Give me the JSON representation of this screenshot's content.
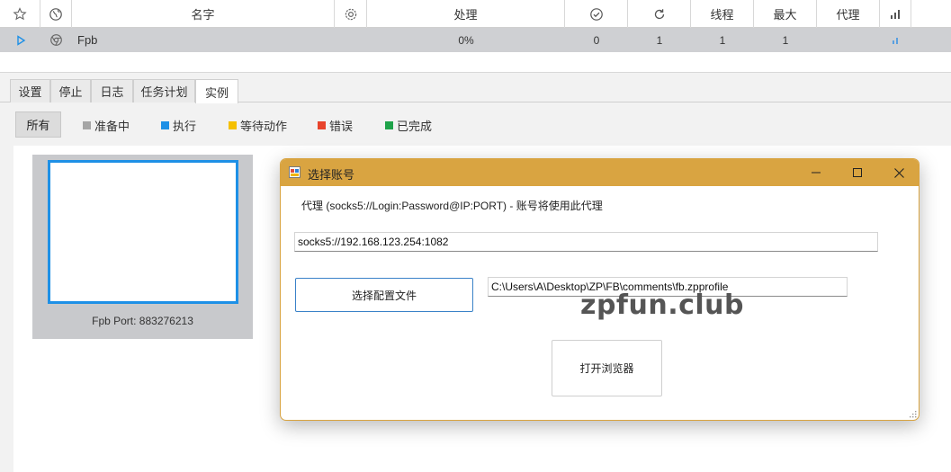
{
  "grid": {
    "headers": {
      "name": "名字",
      "progress": "处理",
      "threads": "线程",
      "max": "最大",
      "proxy": "代理"
    },
    "row": {
      "name": "Fpb",
      "progress": "0%",
      "done": "0",
      "repeat": "1",
      "threads": "1",
      "max": "1"
    }
  },
  "tabs": [
    "设置",
    "停止",
    "日志",
    "任务计划",
    "实例"
  ],
  "active_tab": "实例",
  "filters": {
    "all": "所有",
    "legend": [
      {
        "label": "准备中",
        "color": "#a6a6a6"
      },
      {
        "label": "执行",
        "color": "#1e90e6"
      },
      {
        "label": "等待动作",
        "color": "#f5c000"
      },
      {
        "label": "错误",
        "color": "#e8442c"
      },
      {
        "label": "已完成",
        "color": "#1fa34a"
      }
    ]
  },
  "instance": {
    "caption": "Fpb Port: 883276213"
  },
  "dialog": {
    "title": "选择账号",
    "proxy_label": "代理 (socks5://Login:Password@IP:PORT) - 账号将使用此代理",
    "proxy_value": "socks5://192.168.123.254:1082",
    "config_button": "选择配置文件",
    "profile_path": "C:\\Users\\A\\Desktop\\ZP\\FB\\comments\\fb.zpprofile",
    "open_browser_button": "打开浏览器",
    "watermark": "zpfun.club"
  },
  "colors": {
    "accent_blue": "#1e90e6",
    "dialog_titlebar": "#d9a441",
    "row_selected": "#cfd0d3"
  }
}
